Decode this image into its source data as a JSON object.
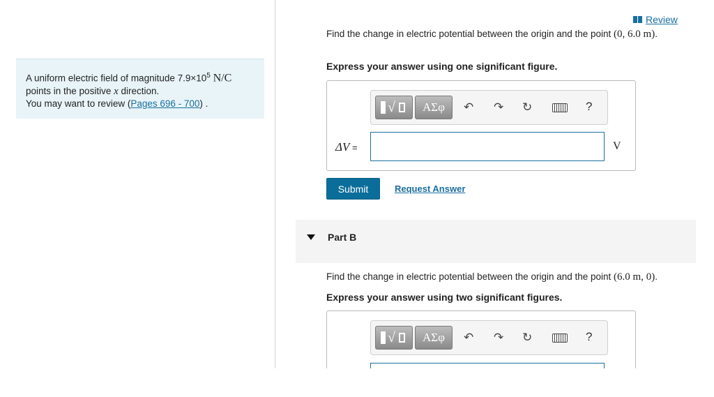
{
  "review": {
    "label": "Review"
  },
  "problem": {
    "intro": "A uniform electric field of magnitude 7.9×10",
    "exponent": "5",
    "unit": "N/C",
    "line2_pre": "points in the positive ",
    "line2_var": "x",
    "line2_post": " direction.",
    "review_pre": "You may want to review (",
    "review_link": "Pages 696 - 700",
    "review_post": ") ."
  },
  "part_a": {
    "question_pre": "Find the change in electric potential between the origin and the point ",
    "point": "(0, 6.0 m)",
    "question_post": ".",
    "instruction": "Express your answer using one significant figure.",
    "answer_label_symbol": "ΔV",
    "answer_label_eq": " = ",
    "answer_value": "",
    "answer_unit": "V",
    "submit_label": "Submit",
    "request_label": "Request Answer"
  },
  "toolbar": {
    "symbols_label": "ΑΣφ",
    "help_label": "?"
  },
  "part_b": {
    "title": "Part B",
    "question_pre": "Find the change in electric potential between the origin and the point ",
    "point": "(6.0 m, 0)",
    "question_post": ".",
    "instruction": "Express your answer using two significant figures."
  },
  "colors": {
    "accent": "#0b6e9a",
    "link": "#1a6ea0",
    "info_bg": "#e8f4f8"
  }
}
